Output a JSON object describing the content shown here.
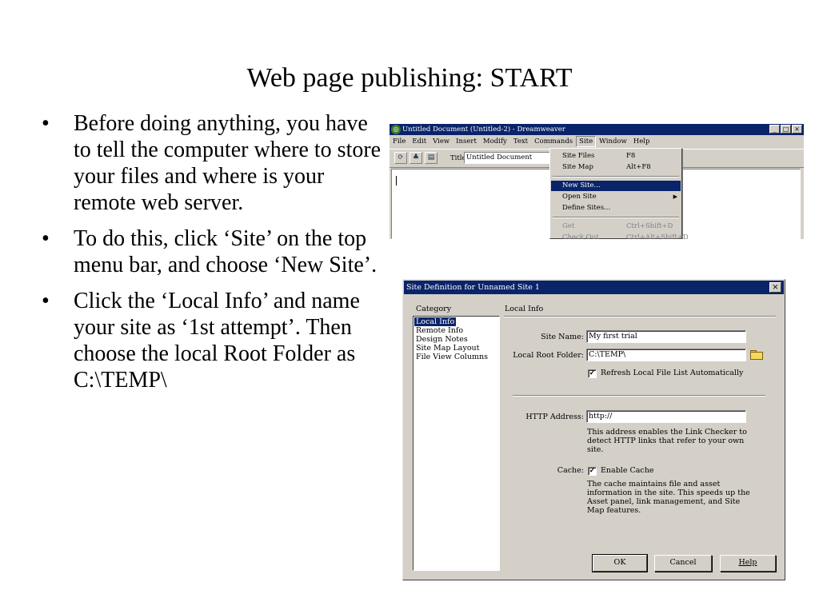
{
  "slide": {
    "title": "Web page publishing: START",
    "bullet_symbol": "•",
    "bullets": [
      "Before doing anything, you have to tell the computer where to store your files and where is your remote web server.",
      "To do this, click ‘Site’ on the top menu bar, and choose ‘New Site’.",
      "Click the ‘Local Info’ and name your site as ‘1st attempt’. Then choose the local Root Folder as C:\\TEMP\\"
    ]
  },
  "dreamweaver": {
    "window_title": "Untitled Document (Untitled-2) - Dreamweaver",
    "window_buttons": [
      "_",
      "□",
      "×"
    ],
    "menu": [
      "File",
      "Edit",
      "View",
      "Insert",
      "Modify",
      "Text",
      "Commands",
      "Site",
      "Window",
      "Help"
    ],
    "open_menu": "Site",
    "toolbar": {
      "title_label": "Title",
      "title_value": "Untitled Document"
    },
    "site_menu": [
      {
        "label": "Site Files",
        "shortcut": "F8",
        "state": "normal"
      },
      {
        "label": "Site Map",
        "shortcut": "Alt+F8",
        "state": "normal"
      },
      {
        "label": "New Site...",
        "shortcut": "",
        "state": "highlighted"
      },
      {
        "label": "Open Site",
        "shortcut": "",
        "state": "submenu"
      },
      {
        "label": "Define Sites...",
        "shortcut": "",
        "state": "normal"
      },
      {
        "label": "Get",
        "shortcut": "Ctrl+Shift+D",
        "state": "disabled"
      },
      {
        "label": "Check Out",
        "shortcut": "Ctrl+Alt+Shift+D",
        "state": "disabled"
      }
    ]
  },
  "site_definition": {
    "window_title": "Site Definition for Unnamed Site 1",
    "close_glyph": "×",
    "category_label": "Category",
    "section_label": "Local Info",
    "categories": [
      "Local Info",
      "Remote Info",
      "Design Notes",
      "Site Map Layout",
      "File View Columns"
    ],
    "selected_category": "Local Info",
    "site_name": {
      "label": "Site Name:",
      "value": "My first trial"
    },
    "local_root_folder": {
      "label": "Local Root Folder:",
      "value": "C:\\TEMP\\"
    },
    "refresh": {
      "label": "Refresh Local File List Automatically",
      "checked": true
    },
    "http_address": {
      "label": "HTTP Address:",
      "value": "http://",
      "help": "This address enables the Link Checker to detect HTTP links that refer to your own site."
    },
    "cache": {
      "label": "Cache:",
      "checkbox_label": "Enable Cache",
      "checked": true,
      "help": "The cache maintains file and asset information in the site.  This speeds up the Asset panel, link management, and Site Map features."
    },
    "buttons": {
      "ok": "OK",
      "cancel": "Cancel",
      "help": "Help"
    },
    "check_glyph": "✓"
  }
}
